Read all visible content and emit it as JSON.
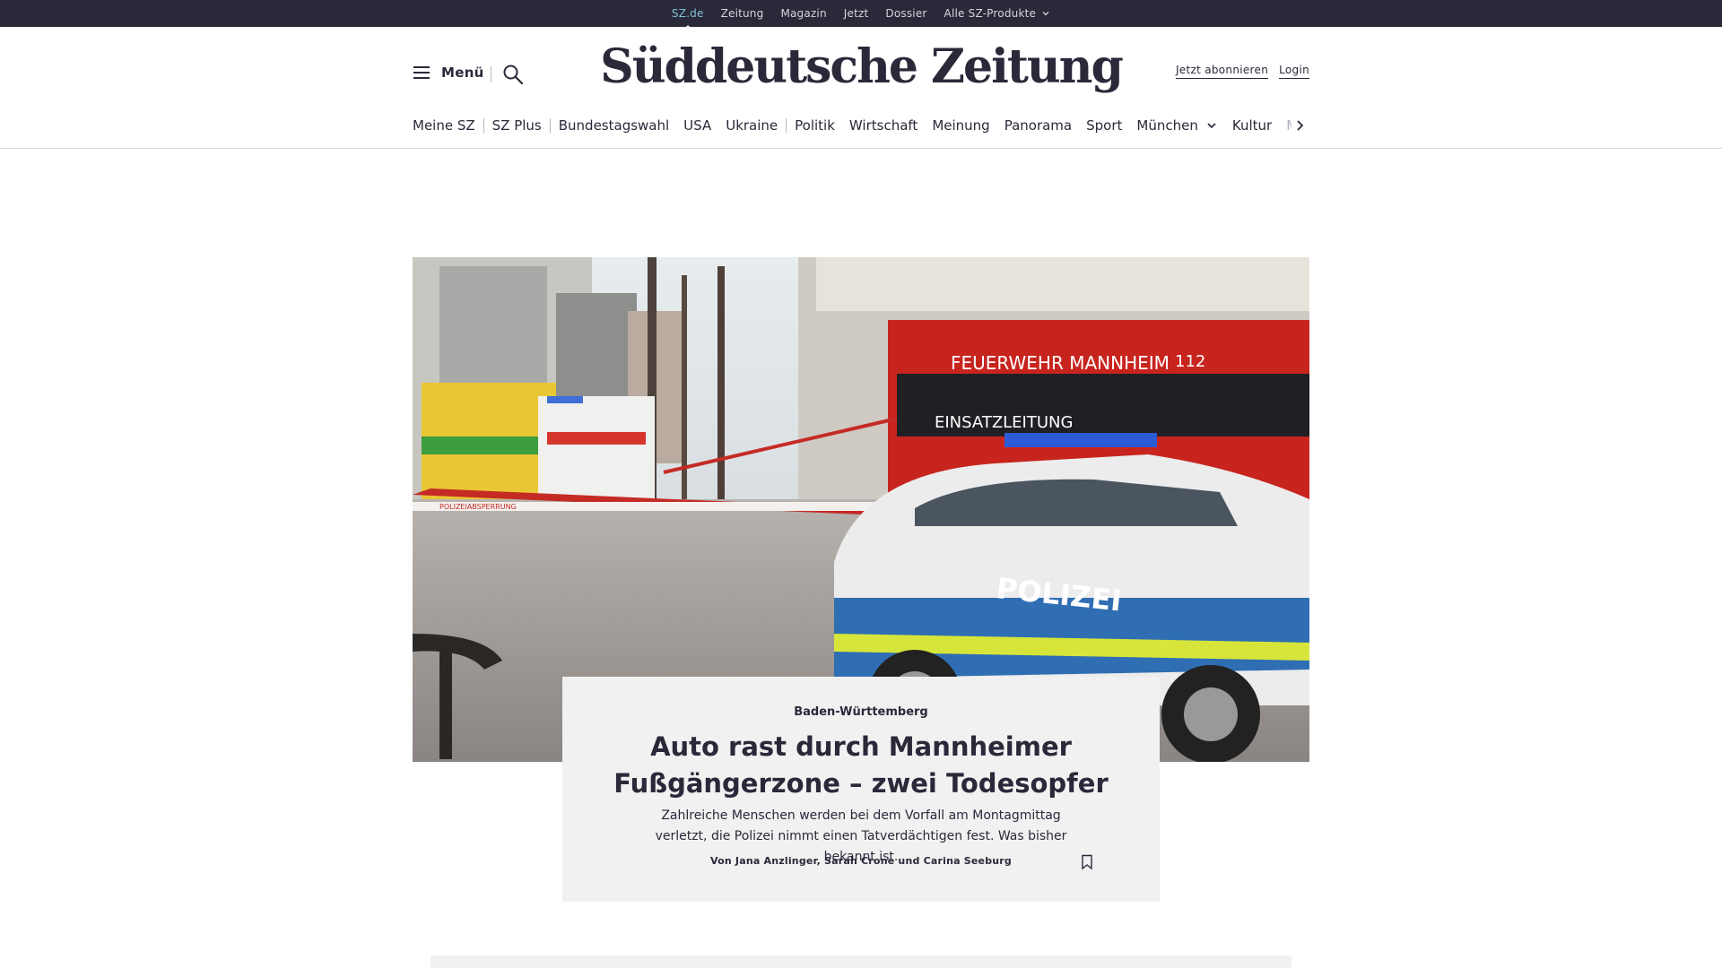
{
  "topbar": {
    "links": [
      {
        "label": "SZ.de",
        "active": true
      },
      {
        "label": "Zeitung"
      },
      {
        "label": "Magazin"
      },
      {
        "label": "Jetzt"
      },
      {
        "label": "Dossier"
      },
      {
        "label": "Alle SZ-Produkte",
        "dropdown": true
      }
    ]
  },
  "header": {
    "menu_label": "Menü",
    "logo": "Süddeutsche Zeitung",
    "subscribe_label": "Jetzt abonnieren",
    "login_label": "Login"
  },
  "nav": {
    "items": [
      "Meine SZ",
      "SZ Plus",
      "Bundestagswahl",
      "USA",
      "Ukraine",
      "Politik",
      "Wirtschaft",
      "Meinung",
      "Panorama",
      "Sport",
      "München",
      "Kultur",
      "M"
    ]
  },
  "hero_image": {
    "signs": {
      "feuerwehr": "FEUERWEHR MANNHEIM",
      "emergency": "112",
      "einsatz": "EINSATZLEITUNG",
      "polizei": "POLIZEI",
      "tape": "POLIZEIABSPERRUNG"
    }
  },
  "teaser": {
    "overline": "Baden-Württemberg",
    "headline": "Auto rast durch Mannheimer Fußgängerzone – zwei Todesopfer",
    "text": "Zahlreiche Menschen werden bei dem Vorfall am Montagmittag verletzt, die Polizei nimmt einen Tatverdächtigen fest. Was bisher bekannt ist.",
    "author": "Von Jana Anzlinger, Sarah Crone und Carina Seeburg"
  },
  "colors": {
    "topbar_bg": "#29293a",
    "active_link": "#7fc3d4",
    "text": "#29293a",
    "card_bg": "#f1f1f1"
  },
  "icons": [
    "hamburger-icon",
    "search-icon",
    "chevron-down-icon",
    "chevron-right-icon",
    "bookmark-icon"
  ]
}
